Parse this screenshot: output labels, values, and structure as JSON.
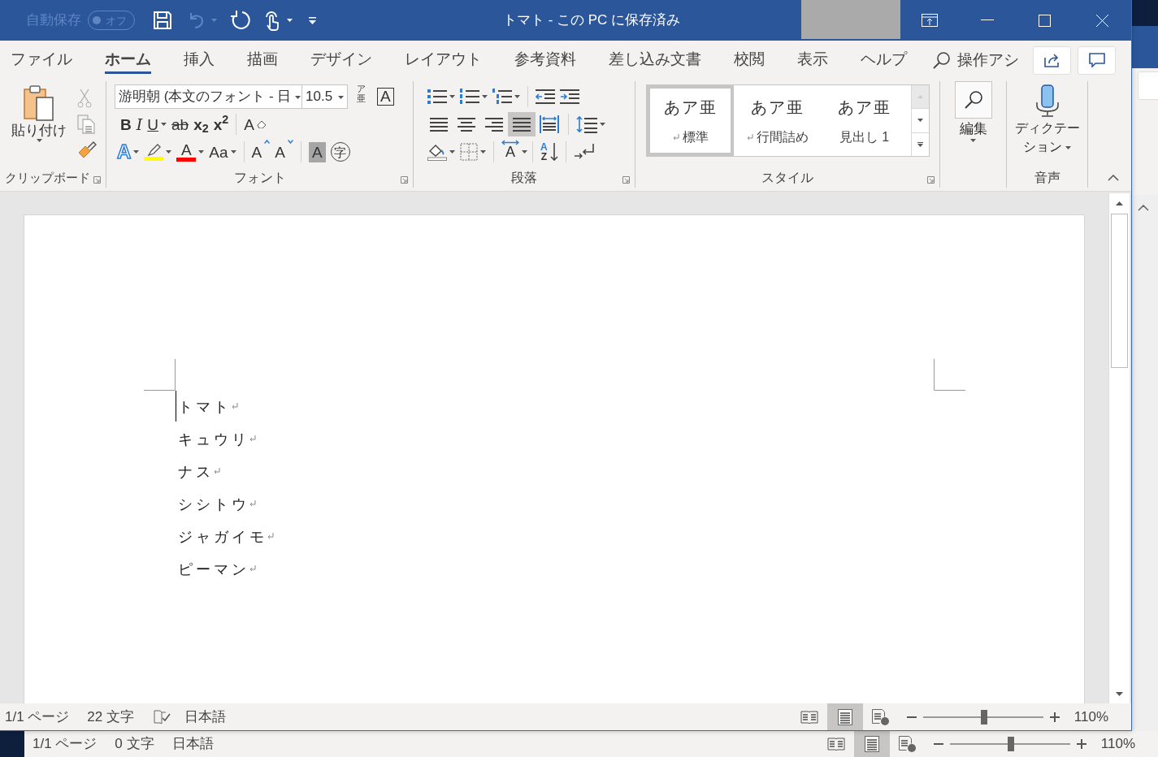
{
  "window": {
    "title": "トマト - この PC に保存済み"
  },
  "quick_access": {
    "autosave_label": "自動保存",
    "autosave": {
      "label": "オフ",
      "on": false
    },
    "undo": {
      "disabled": true
    }
  },
  "tabs": [
    {
      "label": "ファイル",
      "selected": false
    },
    {
      "label": "ホーム",
      "selected": true
    },
    {
      "label": "挿入",
      "selected": false
    },
    {
      "label": "描画",
      "selected": false
    },
    {
      "label": "デザイン",
      "selected": false
    },
    {
      "label": "レイアウト",
      "selected": false
    },
    {
      "label": "参考資料",
      "selected": false
    },
    {
      "label": "差し込み文書",
      "selected": false
    },
    {
      "label": "校閲",
      "selected": false
    },
    {
      "label": "表示",
      "selected": false
    },
    {
      "label": "ヘルプ",
      "selected": false
    }
  ],
  "tell_me": {
    "text": "操作アシ"
  },
  "ribbon": {
    "clipboard": {
      "label": "クリップボード",
      "paste": "貼り付け",
      "cut": {
        "disabled": true
      },
      "copy": {
        "disabled": true
      }
    },
    "font": {
      "label": "フォント",
      "font_name": "游明朝 (本文のフォント - 日",
      "font_size": "10.5",
      "ruby": {
        "top": "ア",
        "bottom": "亜"
      },
      "char_border": "A",
      "row_1": [
        {
          "kind": "bold",
          "label": "B",
          "caret": false
        },
        {
          "kind": "italic",
          "label": "I",
          "caret": false
        },
        {
          "kind": "underline",
          "label": "U",
          "caret": true
        },
        {
          "kind": "strike",
          "label": "ab",
          "caret": false
        },
        {
          "kind": "subscript",
          "label": "x$_{2}$",
          "caret": false
        },
        {
          "kind": "superscript",
          "label": "x$^{2}$",
          "caret": false
        },
        {
          "kind": "clear",
          "label": "A",
          "caret": false
        }
      ],
      "row_2": [
        {
          "kind": "effects",
          "label": "A",
          "caret": true
        },
        {
          "kind": "highlight",
          "color": "#ffff00",
          "caret": true
        },
        {
          "kind": "font_color",
          "label": "A",
          "color": "#ff0000",
          "caret": true
        },
        {
          "kind": "case",
          "label": "Aa",
          "caret": true
        },
        {
          "kind": "grow",
          "label": "A",
          "caret": false
        },
        {
          "kind": "shrink",
          "label": "A",
          "caret": false
        },
        {
          "kind": "shading",
          "label": "A",
          "caret": false
        },
        {
          "kind": "enclose",
          "label": "字",
          "caret": false
        }
      ]
    },
    "paragraph": {
      "label": "段落",
      "alignments": [
        {
          "kind": "left",
          "selected": false
        },
        {
          "kind": "center",
          "selected": false
        },
        {
          "kind": "right",
          "selected": false
        },
        {
          "kind": "justify",
          "selected": true
        },
        {
          "kind": "distributed",
          "selected": false
        }
      ],
      "asian_layout": "A",
      "sort": {
        "top": "A",
        "bottom": "Z"
      }
    },
    "styles": {
      "label": "スタイル",
      "items": [
        {
          "sample": "あア亜",
          "name": "標準",
          "paragraph_mark": true,
          "selected": true
        },
        {
          "sample": "あア亜",
          "name": "行間詰め",
          "paragraph_mark": true,
          "selected": false
        },
        {
          "sample": "あア亜",
          "name": "見出し 1",
          "paragraph_mark": false,
          "selected": false
        }
      ]
    },
    "editing": {
      "label": "編集"
    },
    "voice": {
      "button": "ディクテーション",
      "label": "音声"
    }
  },
  "document": {
    "lines": [
      {
        "text": "トマト",
        "cursor": true
      },
      {
        "text": "キュウリ",
        "cursor": false
      },
      {
        "text": "ナス",
        "cursor": false
      },
      {
        "text": "シシトウ",
        "cursor": false
      },
      {
        "text": "ジャガイモ",
        "cursor": false
      },
      {
        "text": "ピーマン",
        "cursor": false
      }
    ]
  },
  "status_bar": {
    "page": "1/1 ページ",
    "words": "22 文字",
    "language": "日本語",
    "views": [
      {
        "kind": "read",
        "selected": false
      },
      {
        "kind": "print",
        "selected": true
      },
      {
        "kind": "web",
        "selected": false
      }
    ],
    "zoom": {
      "level": 0.51,
      "label": "110%"
    }
  },
  "background_window": {
    "status_bar": {
      "page": "1/1 ページ",
      "words": "0 文字",
      "language": "日本語",
      "views": [
        {
          "kind": "read",
          "selected": false
        },
        {
          "kind": "print",
          "selected": true
        },
        {
          "kind": "web",
          "selected": false
        }
      ],
      "zoom": {
        "level": 0.51,
        "label": "110%"
      }
    }
  }
}
